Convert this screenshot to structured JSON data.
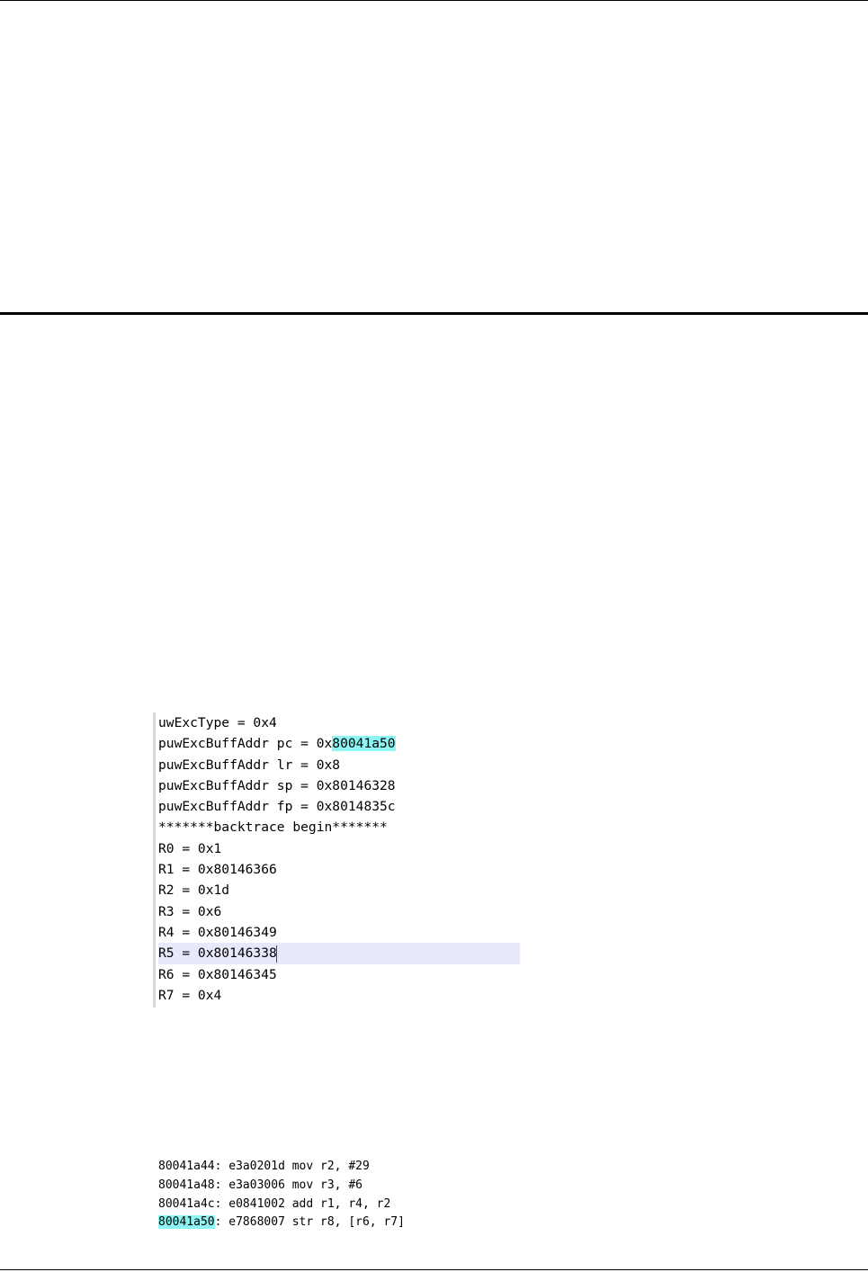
{
  "register_dump": {
    "lines": [
      {
        "text": "uwExcType = 0x4"
      },
      {
        "prefix": "puwExcBuffAddr pc = 0x",
        "highlight": "80041a50",
        "suffix": ""
      },
      {
        "text": "puwExcBuffAddr lr = 0x8"
      },
      {
        "text": "puwExcBuffAddr sp = 0x80146328"
      },
      {
        "text": "puwExcBuffAddr fp = 0x8014835c"
      },
      {
        "text": "*******backtrace begin*******"
      },
      {
        "text": "R0 = 0x1"
      },
      {
        "text": "R1 = 0x80146366"
      },
      {
        "text": "R2 = 0x1d"
      },
      {
        "text": "R3 = 0x6"
      },
      {
        "text": "R4 = 0x80146349"
      },
      {
        "text": "R5 = 0x80146338"
      },
      {
        "text": "R6 = 0x80146345"
      },
      {
        "text": "R7 = 0x4"
      }
    ]
  },
  "disassembly": {
    "lines": [
      {
        "address": "80041a44",
        "rest": ": e3a0201d mov r2, #29"
      },
      {
        "address": "80041a48",
        "rest": ": e3a03006 mov r3, #6"
      },
      {
        "address": "80041a4c",
        "rest": ": e0841002 add r1, r4, r2"
      },
      {
        "address": "80041a50",
        "rest": ": e7868007 str r8, [r6, r7]"
      }
    ]
  },
  "colors": {
    "highlight": "#8ef5f5",
    "current_line": "#e8e8fb",
    "caret": "#7a1fbf"
  }
}
